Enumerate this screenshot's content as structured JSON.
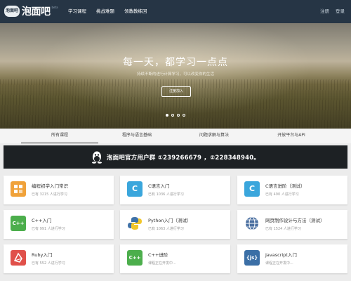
{
  "header": {
    "logo_mark": "泡面吧",
    "logo_text": "泡面吧",
    "logo_sup": "beta",
    "nav": [
      "学习课程",
      "挑战难题",
      "领教教练回"
    ],
    "right_links": [
      "注册",
      "登录"
    ]
  },
  "hero": {
    "title": "每一天，都学习一点点",
    "subtitle": "持续不断的进行计算学习，可以改变你的生活",
    "button_label": "注册加入",
    "slide_count": 4,
    "active_slide": 1
  },
  "tabs": [
    "所有课程",
    "程序与语言基础",
    "问题求解与算法",
    "开放平台与API"
  ],
  "banner": {
    "icon": "qq-penguin-icon",
    "text": "泡面吧官方用户群 ①239266679 ，②228348940。"
  },
  "courses": [
    {
      "title": "编程初学入门常识",
      "sub": "已有 3215 人进行学习",
      "icon": "lightbulb-grid-icon",
      "color": "#f0a23a"
    },
    {
      "title": "C语言入门",
      "sub": "已有 1036 人进行学习",
      "icon": "c-language-icon",
      "color": "#3aa6dc"
    },
    {
      "title": "C语言进阶（测试）",
      "sub": "已有 490 人进行学习",
      "icon": "c-language-icon",
      "color": "#3aa6dc"
    },
    {
      "title": "C++入门",
      "sub": "已有 991 人进行学习",
      "icon": "cpp-language-icon",
      "color": "#4cae4c"
    },
    {
      "title": "Python入门（测试）",
      "sub": "已有 1063 人进行学习",
      "icon": "python-icon",
      "color": "#3f72a8"
    },
    {
      "title": "网页制作设计与方法（测试）",
      "sub": "已有 1524 人进行学习",
      "icon": "globe-icon",
      "color": "#4a6fa0"
    },
    {
      "title": "Ruby入门",
      "sub": "已有 552 人进行学习",
      "icon": "ruby-icon",
      "color": "#e0504a"
    },
    {
      "title": "C++进阶",
      "sub": "课程正在开发中...",
      "icon": "cpp-language-icon",
      "color": "#4cae4c"
    },
    {
      "title": "Javascript入门",
      "sub": "课程正在开发中...",
      "icon": "javascript-icon",
      "color": "#3b6fa6"
    }
  ]
}
